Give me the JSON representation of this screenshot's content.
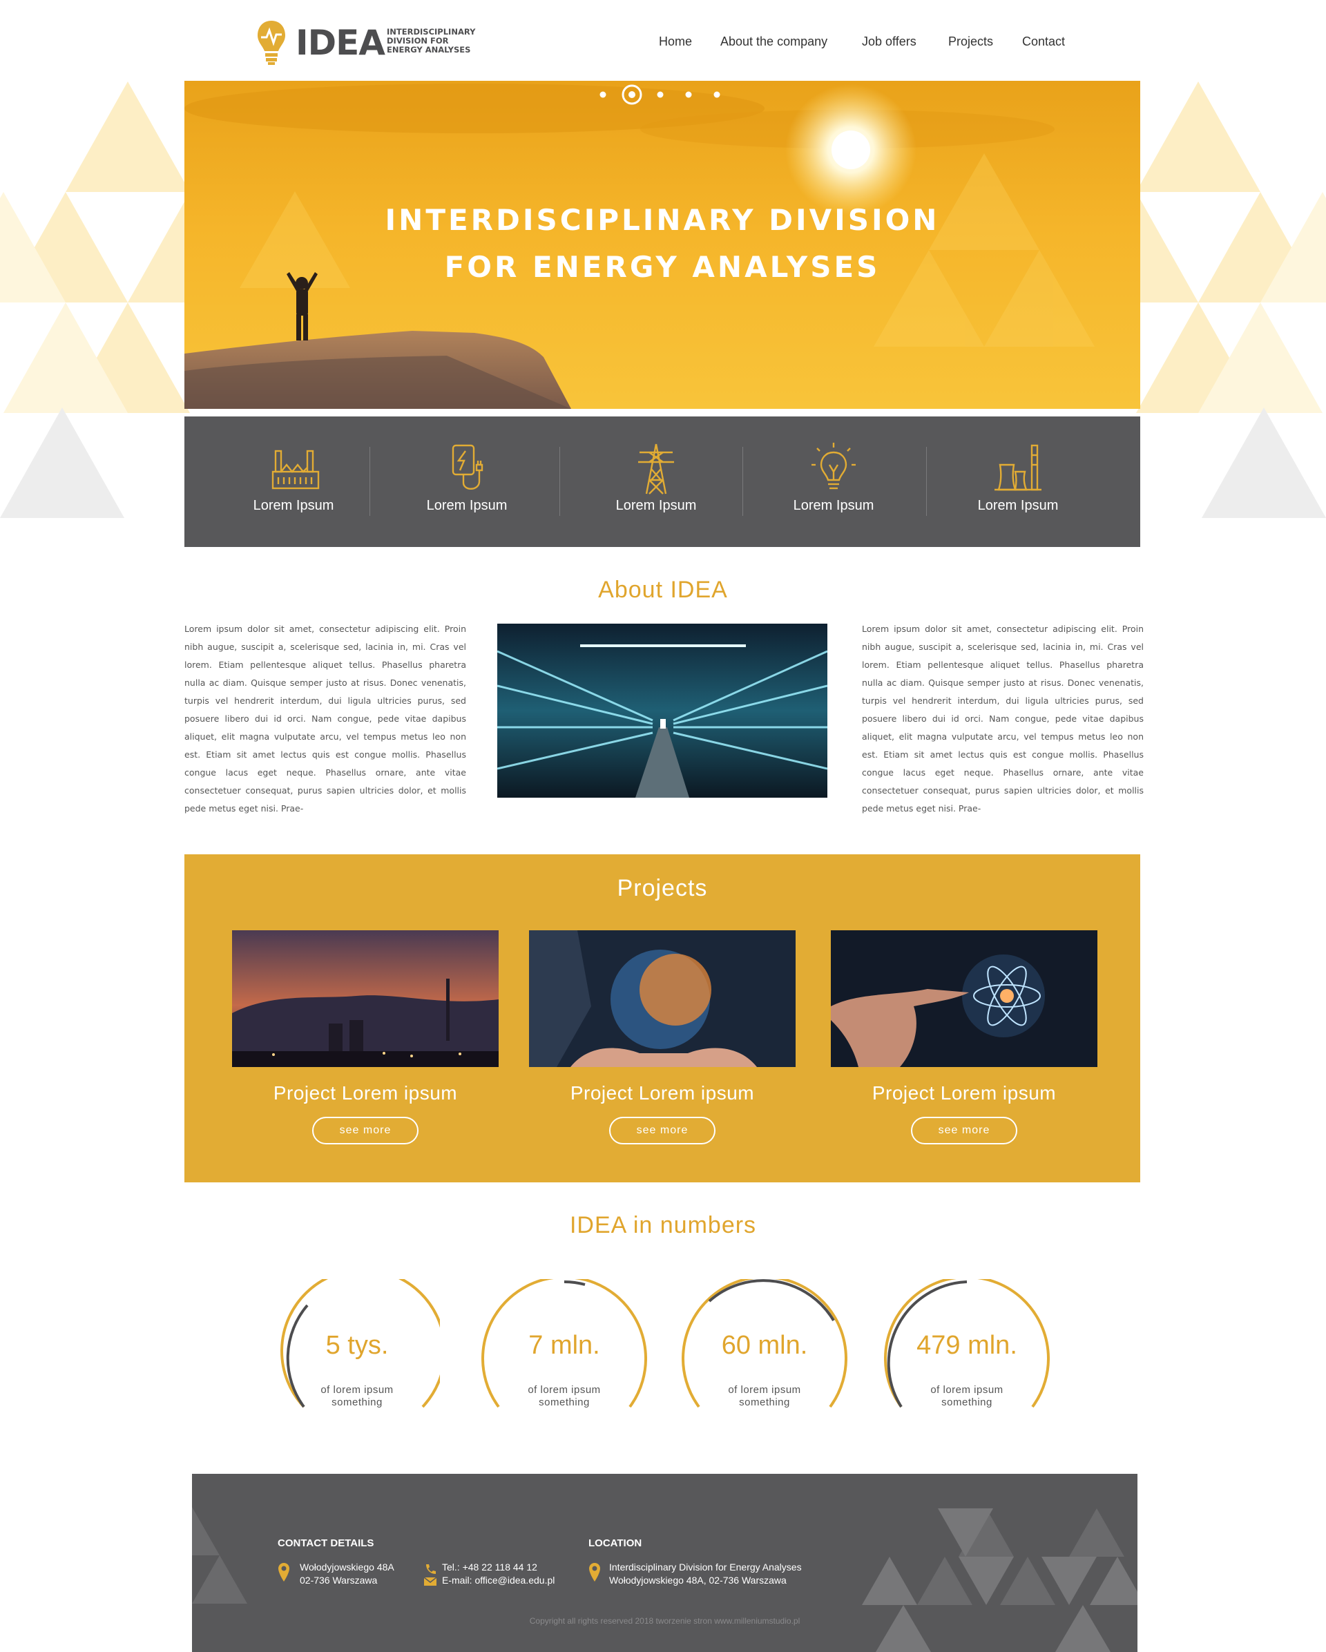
{
  "brand": {
    "name": "IDEA",
    "tagline_lines": [
      "INTERDISCIPLINARY",
      "DIVISION FOR",
      "ENERGY ANALYSES"
    ],
    "accent_color": "#e2ac34",
    "dark_color": "#58585a"
  },
  "nav": {
    "items": [
      "Home",
      "About the company",
      "Job offers",
      "Projects",
      "Contact"
    ]
  },
  "hero": {
    "title_line1": "INTERDISCIPLINARY DIVISION",
    "title_line2": "FOR  ENERGY ANALYSES",
    "slides_count": 5,
    "active_slide": 2
  },
  "services": [
    {
      "label": "Lorem Ipsum",
      "icon": "factory-icon"
    },
    {
      "label": "Lorem Ipsum",
      "icon": "charger-icon"
    },
    {
      "label": "Lorem Ipsum",
      "icon": "power-tower-icon"
    },
    {
      "label": "Lorem Ipsum",
      "icon": "lightbulb-icon"
    },
    {
      "label": "Lorem Ipsum",
      "icon": "power-plant-icon"
    }
  ],
  "about": {
    "title": "About IDEA",
    "left_text": "Lorem ipsum dolor sit amet, consectetur adipiscing elit. Proin nibh augue, suscipit a, scelerisque sed, lacinia in, mi. Cras vel lorem. Etiam pellentesque aliquet tellus. Phasellus pharetra nulla ac diam. Quisque semper justo at risus. Donec venenatis, turpis vel hendrerit interdum, dui ligula ultricies purus, sed posuere libero dui id orci. Nam congue, pede vitae dapibus aliquet, elit magna vulputate arcu, vel tempus metus leo non est. Etiam sit amet lectus quis est congue mollis. Phasellus congue lacus eget neque. Phasellus ornare, ante vitae consectetuer consequat, purus sapien ultricies dolor, et mollis pede metus eget nisi. Prae-",
    "right_text": "Lorem ipsum dolor sit amet, consectetur adipiscing elit. Proin nibh augue, suscipit a, scelerisque sed, lacinia in, mi. Cras vel lorem. Etiam pellentesque aliquet tellus. Phasellus pharetra nulla ac diam. Quisque semper justo at risus. Donec venenatis, turpis vel hendrerit interdum, dui ligula ultricies purus, sed posuere libero dui id orci. Nam congue, pede vitae dapibus aliquet, elit magna vulputate arcu, vel tempus metus leo non est. Etiam sit amet lectus quis est congue mollis. Phasellus congue lacus eget neque. Phasellus ornare, ante vitae consectetuer consequat, purus sapien ultricies dolor, et mollis pede metus eget nisi. Prae-"
  },
  "projects": {
    "title": "Projects",
    "items": [
      {
        "title": "Project Lorem ipsum",
        "button": "see more"
      },
      {
        "title": "Project Lorem ipsum",
        "button": "see more"
      },
      {
        "title": "Project Lorem ipsum",
        "button": "see more"
      }
    ]
  },
  "numbers": {
    "title": "IDEA in numbers",
    "items": [
      {
        "value": "5 tys.",
        "caption_line1": "of lorem ipsum",
        "caption_line2": "something"
      },
      {
        "value": "7 mln.",
        "caption_line1": "of lorem ipsum",
        "caption_line2": "something"
      },
      {
        "value": "60 mln.",
        "caption_line1": "of lorem ipsum",
        "caption_line2": "something"
      },
      {
        "value": "479 mln.",
        "caption_line1": "of lorem ipsum",
        "caption_line2": "something"
      }
    ]
  },
  "footer": {
    "contact_heading": "CONTACT DETAILS",
    "address_line1": "Wołodyjowskiego 48A",
    "address_line2": "02-736 Warszawa",
    "phone": "Tel.: +48 22 118 44 12",
    "email": "E-mail: office@idea.edu.pl",
    "location_heading": "LOCATION",
    "location_line1": "Interdisciplinary Division for Energy Analyses",
    "location_line2": "Wołodyjowskiego 48A, 02-736 Warszawa",
    "copyright": "Copyright all rights reserved 2018    tworzenie stron www.milleniumstudio.pl"
  }
}
